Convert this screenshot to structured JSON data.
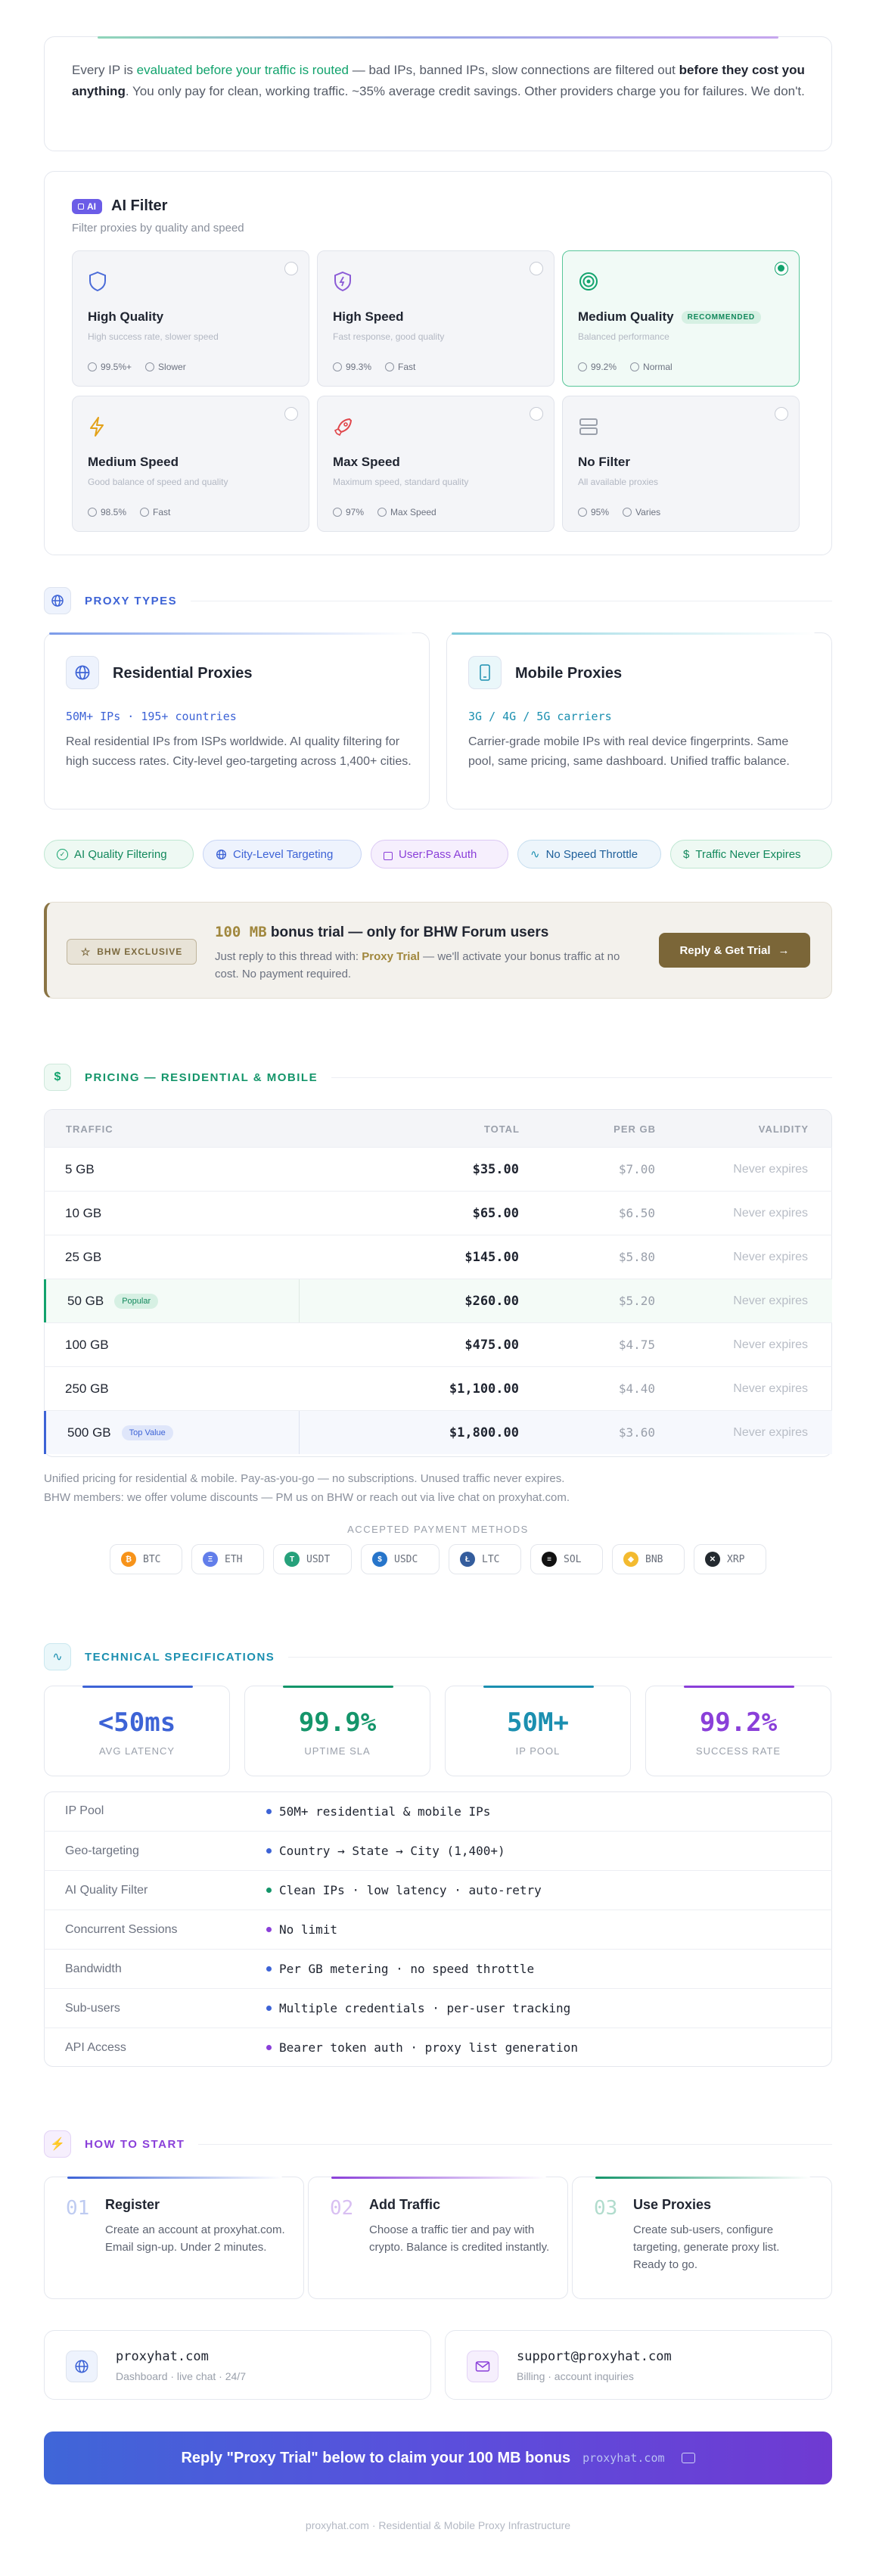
{
  "intro": {
    "p1": "Every IP is ",
    "p_hl": "evaluated before your traffic is routed",
    "p2": " — bad IPs, banned IPs, slow connections are filtered out ",
    "p_bold": "before they cost you anything",
    "p3": ". You only pay for clean, working traffic. ~35% average credit savings. Other providers charge you for failures. We don't."
  },
  "ai_filter": {
    "badge": "AI",
    "title": "AI Filter",
    "subtitle": "Filter proxies by quality and speed",
    "options": [
      {
        "title": "High Quality",
        "desc": "High success rate, slower speed",
        "rate": "99.5%+",
        "speed": "Slower",
        "selected": false,
        "icon": "shield-icon",
        "color": "#4a6bd8"
      },
      {
        "title": "High Speed",
        "desc": "Fast response, good quality",
        "rate": "99.3%",
        "speed": "Fast",
        "selected": false,
        "icon": "shield-bolt-icon",
        "color": "#8b5bd6"
      },
      {
        "title": "Medium Quality",
        "tag": "RECOMMENDED",
        "desc": "Balanced performance",
        "rate": "99.2%",
        "speed": "Normal",
        "selected": true,
        "icon": "target-icon",
        "color": "#12a36d"
      },
      {
        "title": "Medium Speed",
        "desc": "Good balance of speed and quality",
        "rate": "98.5%",
        "speed": "Fast",
        "selected": false,
        "icon": "bolt-icon",
        "color": "#e3a21a"
      },
      {
        "title": "Max Speed",
        "desc": "Maximum speed, standard quality",
        "rate": "97%",
        "speed": "Max Speed",
        "selected": false,
        "icon": "rocket-icon",
        "color": "#e0474c"
      },
      {
        "title": "No Filter",
        "desc": "All available proxies",
        "rate": "95%",
        "speed": "Varies",
        "selected": false,
        "icon": "server-icon",
        "color": "#9aa0ab"
      }
    ]
  },
  "proxy_types": {
    "heading": "PROXY TYPES",
    "residential": {
      "title": "Residential Proxies",
      "stats": "50M+ IPs · 195+ countries",
      "desc": "Real residential IPs from ISPs worldwide. AI quality filtering for high success rates. City-level geo-targeting across 1,400+ cities."
    },
    "mobile": {
      "title": "Mobile Proxies",
      "stats": "3G / 4G / 5G carriers",
      "desc": "Carrier-grade mobile IPs with real device fingerprints. Same pool, same pricing, same dashboard. Unified traffic balance."
    }
  },
  "features": [
    {
      "label": "AI Quality Filtering",
      "icon": "check-circle-icon"
    },
    {
      "label": "City-Level Targeting",
      "icon": "globe-icon"
    },
    {
      "label": "User:Pass Auth",
      "icon": "lock-icon"
    },
    {
      "label": "No Speed Throttle",
      "icon": "pulse-icon"
    },
    {
      "label": "Traffic Never Expires",
      "icon": "dollar-icon"
    }
  ],
  "bonus": {
    "badge": "BHW EXCLUSIVE",
    "amount": "100 MB",
    "title_rest": " bonus trial — only for BHW Forum users",
    "desc1": "Just reply to this thread with: ",
    "desc_hl": "Proxy Trial",
    "desc2": " — we'll activate your bonus traffic at no cost. No payment required.",
    "button": "Reply & Get Trial"
  },
  "pricing": {
    "heading": "PRICING — RESIDENTIAL & MOBILE",
    "columns": [
      "TRAFFIC",
      "TOTAL",
      "PER GB",
      "VALIDITY"
    ],
    "rows": [
      {
        "traffic": "5 GB",
        "total": "$35.00",
        "per_gb": "$7.00",
        "validity": "Never expires",
        "badge": ""
      },
      {
        "traffic": "10 GB",
        "total": "$65.00",
        "per_gb": "$6.50",
        "validity": "Never expires",
        "badge": ""
      },
      {
        "traffic": "25 GB",
        "total": "$145.00",
        "per_gb": "$5.80",
        "validity": "Never expires",
        "badge": ""
      },
      {
        "traffic": "50 GB",
        "total": "$260.00",
        "per_gb": "$5.20",
        "validity": "Never expires",
        "badge": "Popular"
      },
      {
        "traffic": "100 GB",
        "total": "$475.00",
        "per_gb": "$4.75",
        "validity": "Never expires",
        "badge": ""
      },
      {
        "traffic": "250 GB",
        "total": "$1,100.00",
        "per_gb": "$4.40",
        "validity": "Never expires",
        "badge": ""
      },
      {
        "traffic": "500 GB",
        "total": "$1,800.00",
        "per_gb": "$3.60",
        "validity": "Never expires",
        "badge": "Top Value"
      }
    ],
    "note1": "Unified pricing for residential & mobile. Pay-as-you-go — no subscriptions. Unused traffic never expires.",
    "note2": "BHW members: we offer volume discounts — PM us on BHW or reach out via live chat on proxyhat.com.",
    "payments_heading": "ACCEPTED PAYMENT METHODS",
    "payments": [
      {
        "name": "BTC",
        "color": "#f7931a",
        "glyph": "₿"
      },
      {
        "name": "ETH",
        "color": "#627eea",
        "glyph": "Ξ"
      },
      {
        "name": "USDT",
        "color": "#26a17b",
        "glyph": "T"
      },
      {
        "name": "USDC",
        "color": "#2775ca",
        "glyph": "$"
      },
      {
        "name": "LTC",
        "color": "#345d9d",
        "glyph": "Ł"
      },
      {
        "name": "SOL",
        "color": "#111111",
        "glyph": "≡"
      },
      {
        "name": "BNB",
        "color": "#f3ba2f",
        "glyph": "◆"
      },
      {
        "name": "XRP",
        "color": "#23292f",
        "glyph": "✕"
      }
    ]
  },
  "tech": {
    "heading": "TECHNICAL SPECIFICATIONS",
    "stats": [
      {
        "value": "<50ms",
        "label": "AVG LATENCY",
        "color": "#3d63d6"
      },
      {
        "value": "99.9%",
        "label": "UPTIME SLA",
        "color": "#14956a"
      },
      {
        "value": "50M+",
        "label": "IP POOL",
        "color": "#1b8fb0"
      },
      {
        "value": "99.2%",
        "label": "SUCCESS RATE",
        "color": "#8a3fd9"
      }
    ],
    "specs": [
      {
        "key": "IP Pool",
        "value": "50M+ residential & mobile IPs",
        "dot": "#3d63d6"
      },
      {
        "key": "Geo-targeting",
        "value": "Country → State → City (1,400+)",
        "dot": "#3d63d6"
      },
      {
        "key": "AI Quality Filter",
        "value": "Clean IPs · low latency · auto-retry",
        "dot": "#14956a"
      },
      {
        "key": "Concurrent Sessions",
        "value": "No limit",
        "dot": "#8a3fd9"
      },
      {
        "key": "Bandwidth",
        "value": "Per GB metering · no speed throttle",
        "dot": "#3d63d6"
      },
      {
        "key": "Sub-users",
        "value": "Multiple credentials · per-user tracking",
        "dot": "#3d63d6"
      },
      {
        "key": "API Access",
        "value": "Bearer token auth · proxy list generation",
        "dot": "#8a3fd9"
      }
    ]
  },
  "how": {
    "heading": "HOW TO START",
    "steps": [
      {
        "num": "01",
        "title": "Register",
        "desc": "Create an account at proxyhat.com. Email sign-up. Under 2 minutes.",
        "color": "#3d63d6"
      },
      {
        "num": "02",
        "title": "Add Traffic",
        "desc": "Choose a traffic tier and pay with crypto. Balance is credited instantly.",
        "color": "#8a3fd9"
      },
      {
        "num": "03",
        "title": "Use Proxies",
        "desc": "Create sub-users, configure targeting, generate proxy list. Ready to go.",
        "color": "#14956a"
      }
    ]
  },
  "contacts": [
    {
      "title": "proxyhat.com",
      "sub": "Dashboard · live chat · 24/7",
      "icon": "globe-icon"
    },
    {
      "title": "support@proxyhat.com",
      "sub": "Billing · account inquiries",
      "icon": "mail-icon"
    }
  ],
  "cta": {
    "text": "Reply \"Proxy Trial\" below to claim your 100 MB bonus",
    "domain": "proxyhat.com"
  },
  "footer": "proxyhat.com · Residential & Mobile Proxy Infrastructure"
}
